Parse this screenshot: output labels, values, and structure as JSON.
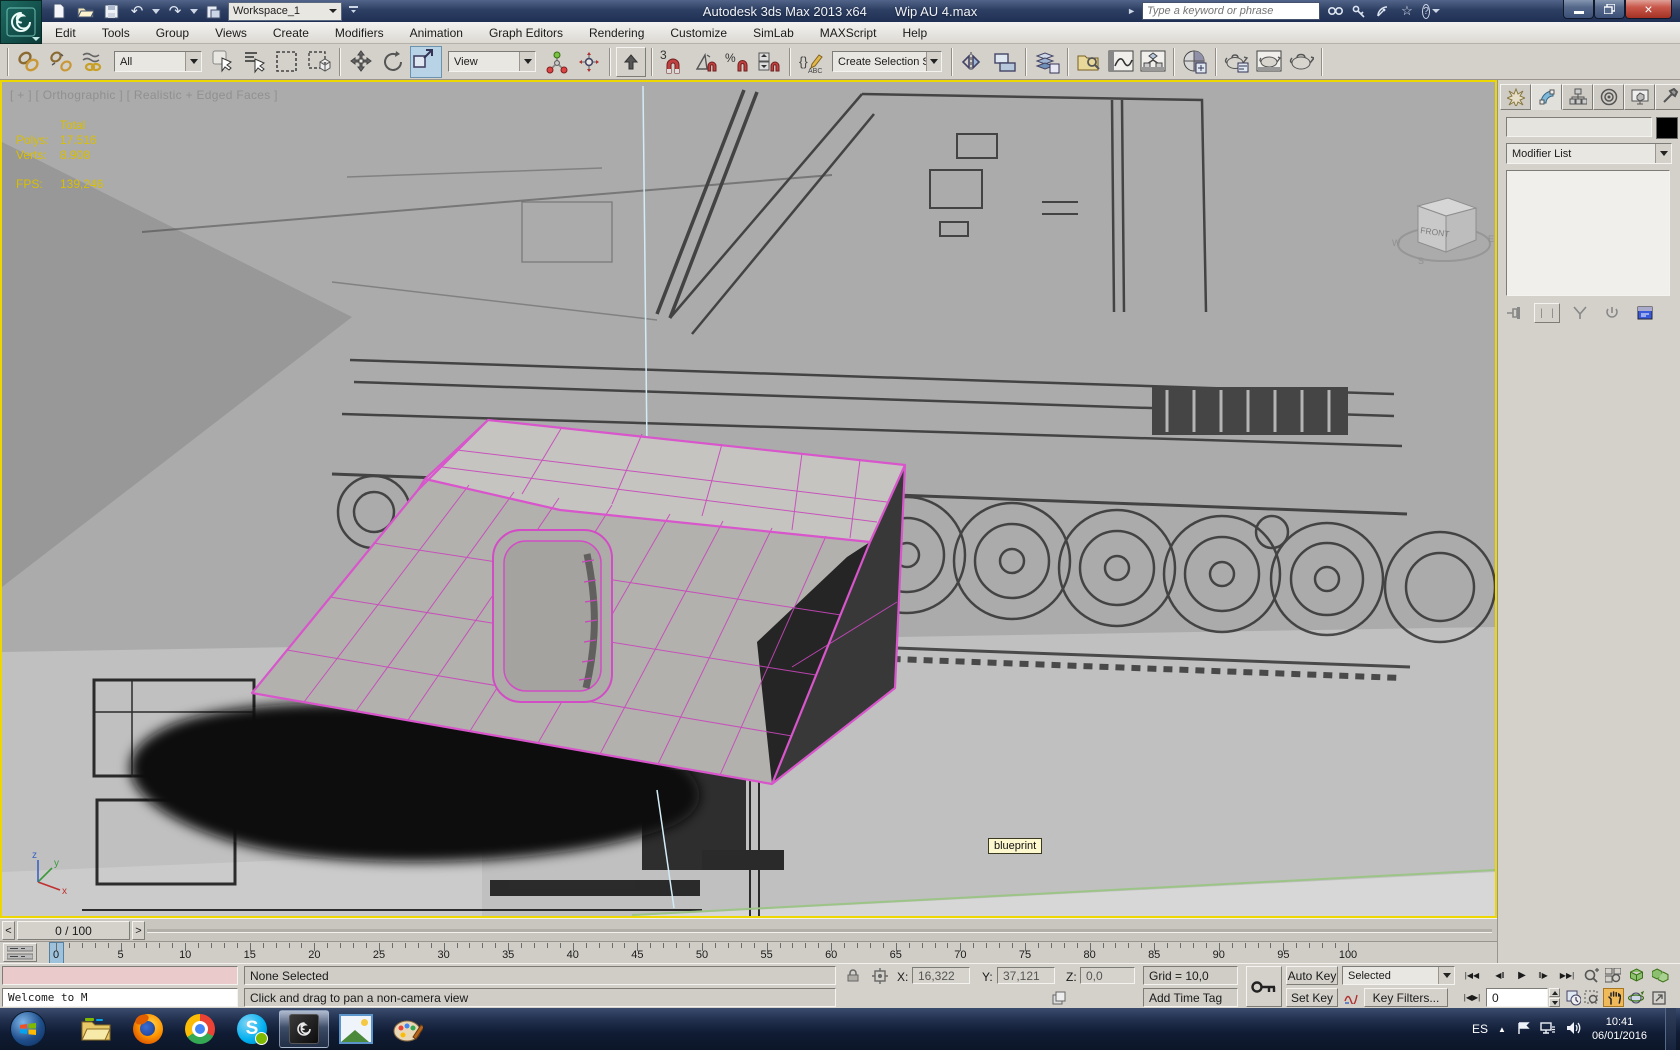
{
  "titlebar": {
    "workspace": "Workspace_1",
    "app_title": "Autodesk 3ds Max 2013 x64",
    "file_title": "Wip AU 4.max",
    "search_placeholder": "Type a keyword or phrase"
  },
  "menubar": {
    "items": [
      "Edit",
      "Tools",
      "Group",
      "Views",
      "Create",
      "Modifiers",
      "Animation",
      "Graph Editors",
      "Rendering",
      "Customize",
      "SimLab",
      "MAXScript",
      "Help"
    ]
  },
  "toolbar": {
    "selection_filter": "All",
    "coordinate_system": "View",
    "selection_set": "Create Selection Se",
    "snap_label": "3"
  },
  "viewport": {
    "label": "[ + ] [ Orthographic ] [ Realistic + Edged Faces ]",
    "stats": {
      "total_label": "Total",
      "polys_label": "Polys:",
      "polys": "17.516",
      "verts_label": "Verts:",
      "verts": "8.908",
      "fps_label": "FPS:",
      "fps": "139,246"
    },
    "viewcube_face": "FRONT",
    "compass": {
      "w": "W",
      "s": "S",
      "e": "E"
    },
    "axis": {
      "x": "x",
      "y": "y",
      "z": "z"
    },
    "tooltip": "blueprint"
  },
  "command_panel": {
    "object_name": "",
    "modifier_list": "Modifier List"
  },
  "timeline": {
    "prev": "<",
    "next": ">",
    "slider_label": "0 / 100",
    "tick_labels": [
      "0",
      "5",
      "10",
      "15",
      "20",
      "25",
      "30",
      "35",
      "40",
      "45",
      "50",
      "55",
      "60",
      "65",
      "70",
      "75",
      "80",
      "85",
      "90",
      "95",
      "100"
    ]
  },
  "statusbar": {
    "listener": "Welcome to M",
    "selection_status": "None Selected",
    "prompt": "Click and drag to pan a non-camera view",
    "x_label": "X:",
    "x_value": "16,322",
    "y_label": "Y:",
    "y_value": "37,121",
    "z_label": "Z:",
    "z_value": "0,0",
    "grid_label": "Grid = 10,0",
    "add_time_tag": "Add Time Tag",
    "auto_key": "Auto Key",
    "set_key": "Set Key",
    "key_mode_selected": "Selected",
    "key_filters": "Key Filters...",
    "frame_value": "0"
  },
  "taskbar": {
    "apps": [
      "windows-explorer",
      "firefox",
      "chrome",
      "skype",
      "3ds-max",
      "photo-viewer",
      "paint"
    ],
    "tray_language": "ES",
    "clock_time": "10:41",
    "clock_date": "06/01/2016"
  },
  "colors": {
    "viewport_border": "#ecd800",
    "stats_text": "#d9be00",
    "wireframe": "#d24cc6",
    "pan_active": "#f0b95a",
    "tooltip_bg": "#fdf8cd"
  }
}
